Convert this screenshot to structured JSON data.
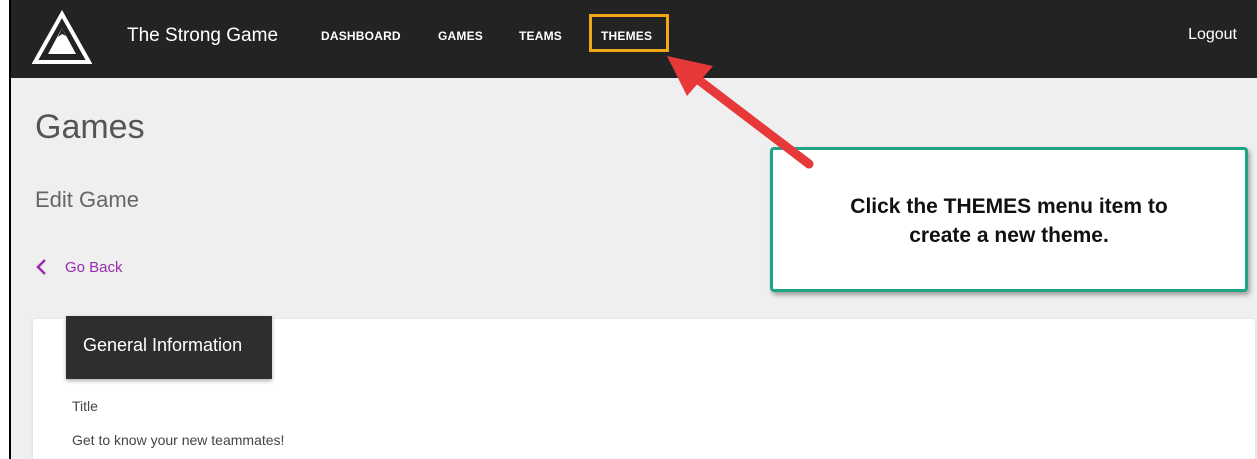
{
  "app": {
    "brand": "The Strong Game",
    "logout_label": "Logout"
  },
  "nav": {
    "items": [
      {
        "label": "DASHBOARD"
      },
      {
        "label": "GAMES"
      },
      {
        "label": "TEAMS"
      },
      {
        "label": "THEMES"
      }
    ],
    "highlight_color": "#f0a818"
  },
  "page": {
    "title": "Games",
    "subtitle": "Edit Game",
    "back_label": "Go Back",
    "accent_color": "#9a2bb0"
  },
  "card": {
    "tab_label": "General Information",
    "field_label": "Title",
    "field_value": "Get to know your new teammates!"
  },
  "callout": {
    "text": "Click the THEMES menu item to\ncreate a new theme.",
    "border_color": "#1fa586",
    "arrow_color": "#e8393a"
  }
}
